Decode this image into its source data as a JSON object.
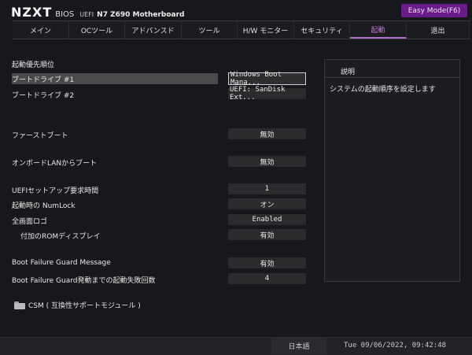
{
  "header": {
    "brand": "NZXT",
    "bios": "BIOS",
    "uefi": "UEFI",
    "model": "N7 Z690 Motherboard",
    "easy_mode": "Easy Mode(F6)"
  },
  "tabs": [
    {
      "label": "メイン"
    },
    {
      "label": "OCツール"
    },
    {
      "label": "アドバンスド"
    },
    {
      "label": "ツール"
    },
    {
      "label": "H/W モニター"
    },
    {
      "label": "セキュリティ"
    },
    {
      "label": "起動"
    },
    {
      "label": "退出"
    }
  ],
  "active_tab": "起動",
  "settings": {
    "section_title": "起動優先順位",
    "boot1_label": "ブートドライブ #1",
    "boot1_value": "Windows Boot Mana...",
    "boot2_label": "ブートドライブ #2",
    "boot2_value": "UEFI: SanDisk Ext...",
    "fastboot_label": "ファーストブート",
    "fastboot_value": "無効",
    "onboard_lan_label": "オンボードLANからブート",
    "onboard_lan_value": "無効",
    "uefi_timeout_label": "UEFIセットアップ要求時間",
    "uefi_timeout_value": "1",
    "numlock_label": "起動時の NumLock",
    "numlock_value": "オン",
    "fullscreen_logo_label": "全画面ロゴ",
    "fullscreen_logo_value": "Enabled",
    "addon_rom_label": "付加のROMディスプレイ",
    "addon_rom_value": "有効",
    "bfg_message_label": "Boot Failure Guard Message",
    "bfg_message_value": "有効",
    "bfg_count_label": "Boot Failure Guard発動までの起動失敗回数",
    "bfg_count_value": "4",
    "csm_label": "CSM ( 互換性サポートモジュール )"
  },
  "help": {
    "title": "説明",
    "text": "システムの起動順序を設定します"
  },
  "footer": {
    "language": "日本語",
    "datetime": "Tue 09/06/2022, 09:42:48"
  },
  "colors": {
    "accent": "#b46dc8",
    "easy_mode_bg": "#6a1b8a",
    "background": "#17181b"
  }
}
